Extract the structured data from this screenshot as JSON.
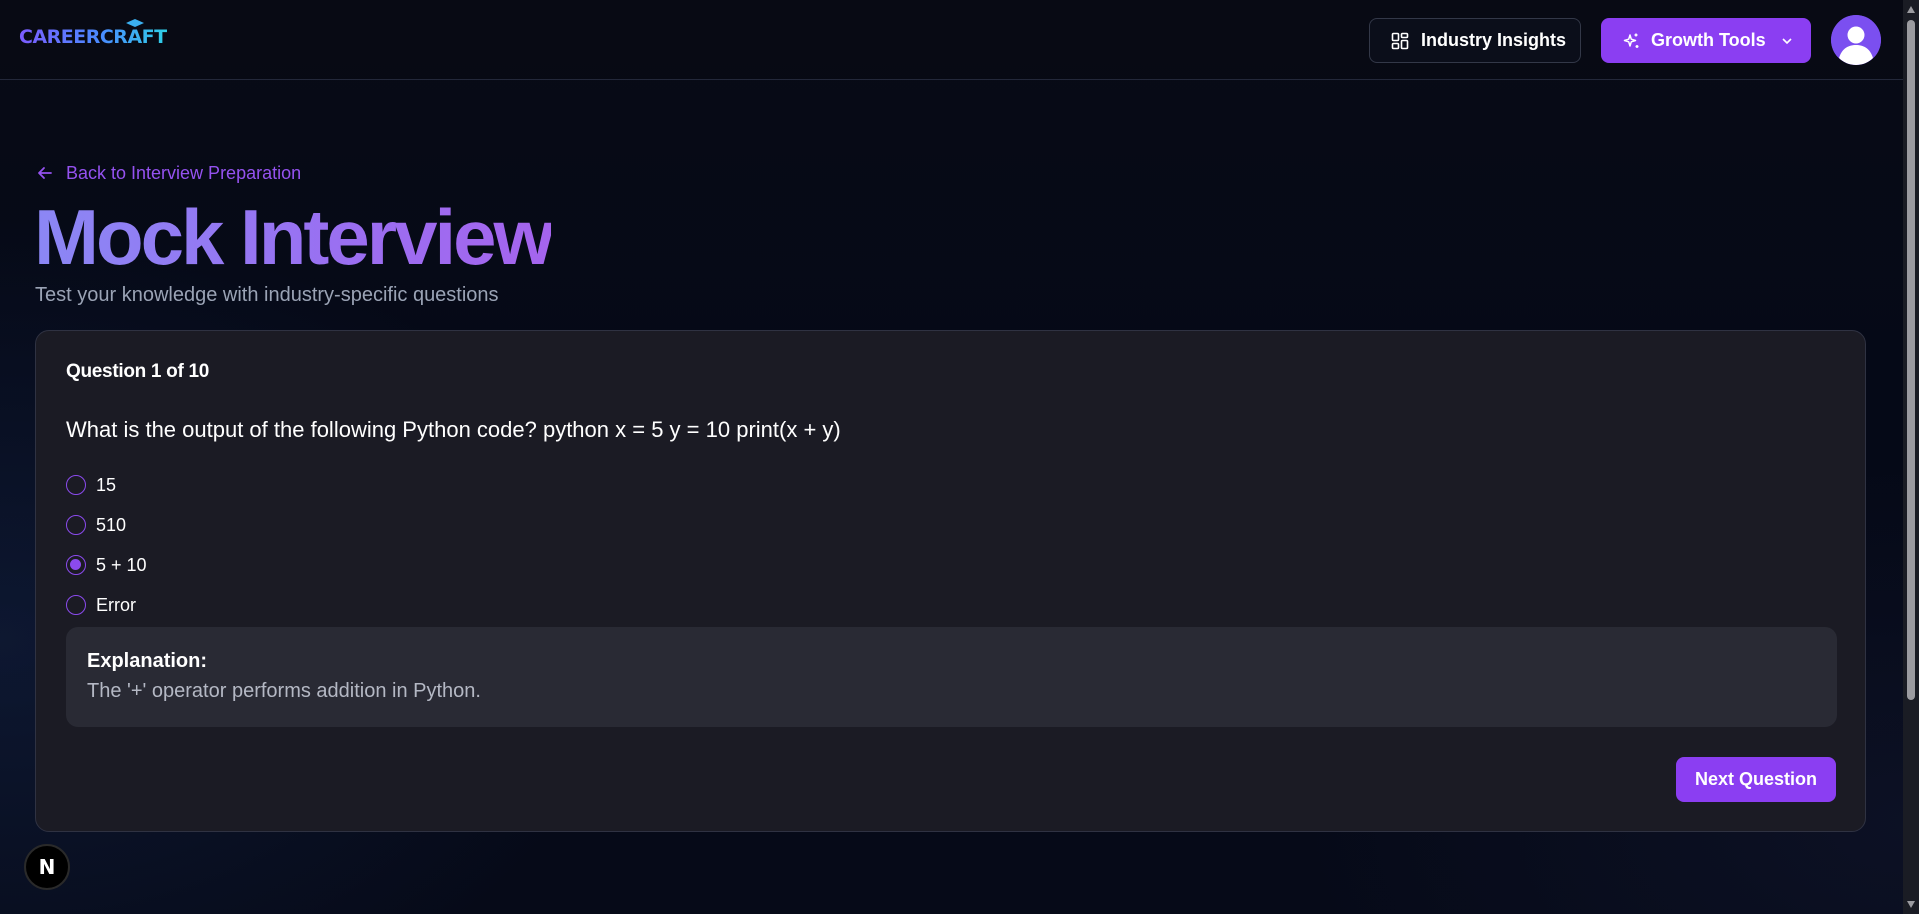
{
  "header": {
    "logo_text": "CAREERCRAFT",
    "industry_insights_label": "Industry Insights",
    "growth_tools_label": "Growth Tools",
    "industry_icon": "dashboard-icon",
    "growth_icon": "sparkles-icon",
    "chevron_icon": "chevron-down-icon",
    "avatar_icon": "user-avatar-icon"
  },
  "nav": {
    "back_label": "Back to Interview Preparation",
    "back_icon": "arrow-left-icon"
  },
  "page": {
    "title": "Mock Interview",
    "subtitle": "Test your knowledge with industry-specific questions"
  },
  "quiz": {
    "question_counter": "Question 1 of 10",
    "question_text": "What is the output of the following Python code? python x = 5 y = 10 print(x + y)",
    "options": [
      {
        "label": "15",
        "selected": false
      },
      {
        "label": "510",
        "selected": false
      },
      {
        "label": "5 + 10",
        "selected": true
      },
      {
        "label": "Error",
        "selected": false
      }
    ],
    "explanation_heading": "Explanation:",
    "explanation_text": "The '+' operator performs addition in Python.",
    "next_label": "Next Question"
  },
  "badge": {
    "label": "N",
    "icon": "nextjs-icon"
  },
  "colors": {
    "accent": "#8b3ef2",
    "background": "#060a17",
    "card": "#1b1b24"
  }
}
